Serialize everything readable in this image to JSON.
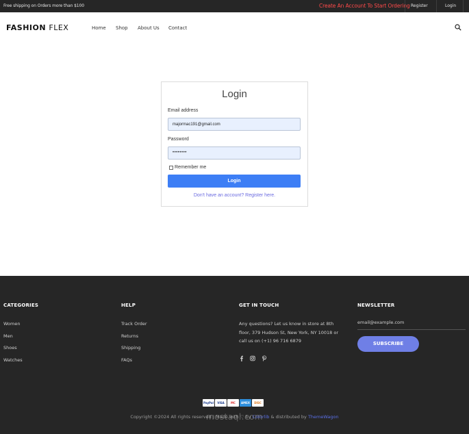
{
  "topbar": {
    "promo": "Free shipping on Orders more than $100",
    "cta": "Create An Account To Start Ordering",
    "register": "Register",
    "login": "Login"
  },
  "nav": {
    "brand_bold": "FASHION",
    "brand_light": "FLEX",
    "links": [
      "Home",
      "Shop",
      "About Us",
      "Contact"
    ],
    "search_icon": "search-icon"
  },
  "login_form": {
    "title": "Login",
    "email_label": "Email address",
    "email_value": "majormac191@gmail.com",
    "password_label": "Password",
    "password_value": "••••••••",
    "remember_label": "Remember me",
    "remember_checked": false,
    "submit_label": "Login",
    "register_link": "Don't have an account? Register here.",
    "accent_color": "#3d7ef5"
  },
  "footer": {
    "categories": {
      "title": "CATEGORIES",
      "items": [
        "Women",
        "Men",
        "Shoes",
        "Watches"
      ]
    },
    "help": {
      "title": "HELP",
      "items": [
        "Track Order",
        "Returns",
        "Shipping",
        "FAQs"
      ]
    },
    "contact": {
      "title": "GET IN TOUCH",
      "text": "Any questions? Let us know in store at 8th floor, 379 Hudson St, New York, NY 10018 or call us on (+1) 96 716 6879",
      "social_icons": [
        "facebook-icon",
        "instagram-icon",
        "pinterest-icon"
      ]
    },
    "newsletter": {
      "title": "NEWSLETTER",
      "placeholder": "email@example.com",
      "button_label": "SUBSCRIBE",
      "button_color": "#6f7fe6"
    },
    "payment_icons": [
      "PayPal",
      "VISA",
      "MC",
      "AMEX",
      "DISC"
    ],
    "copyright_pre": "Copyright ©2024 All rights reserved | Made with ♡ by ",
    "copyright_colorlib": "Colorlib",
    "copyright_mid": " & distributed by ",
    "copyright_themewagon": "ThemeWagon",
    "watermark": "mostaql.com"
  }
}
